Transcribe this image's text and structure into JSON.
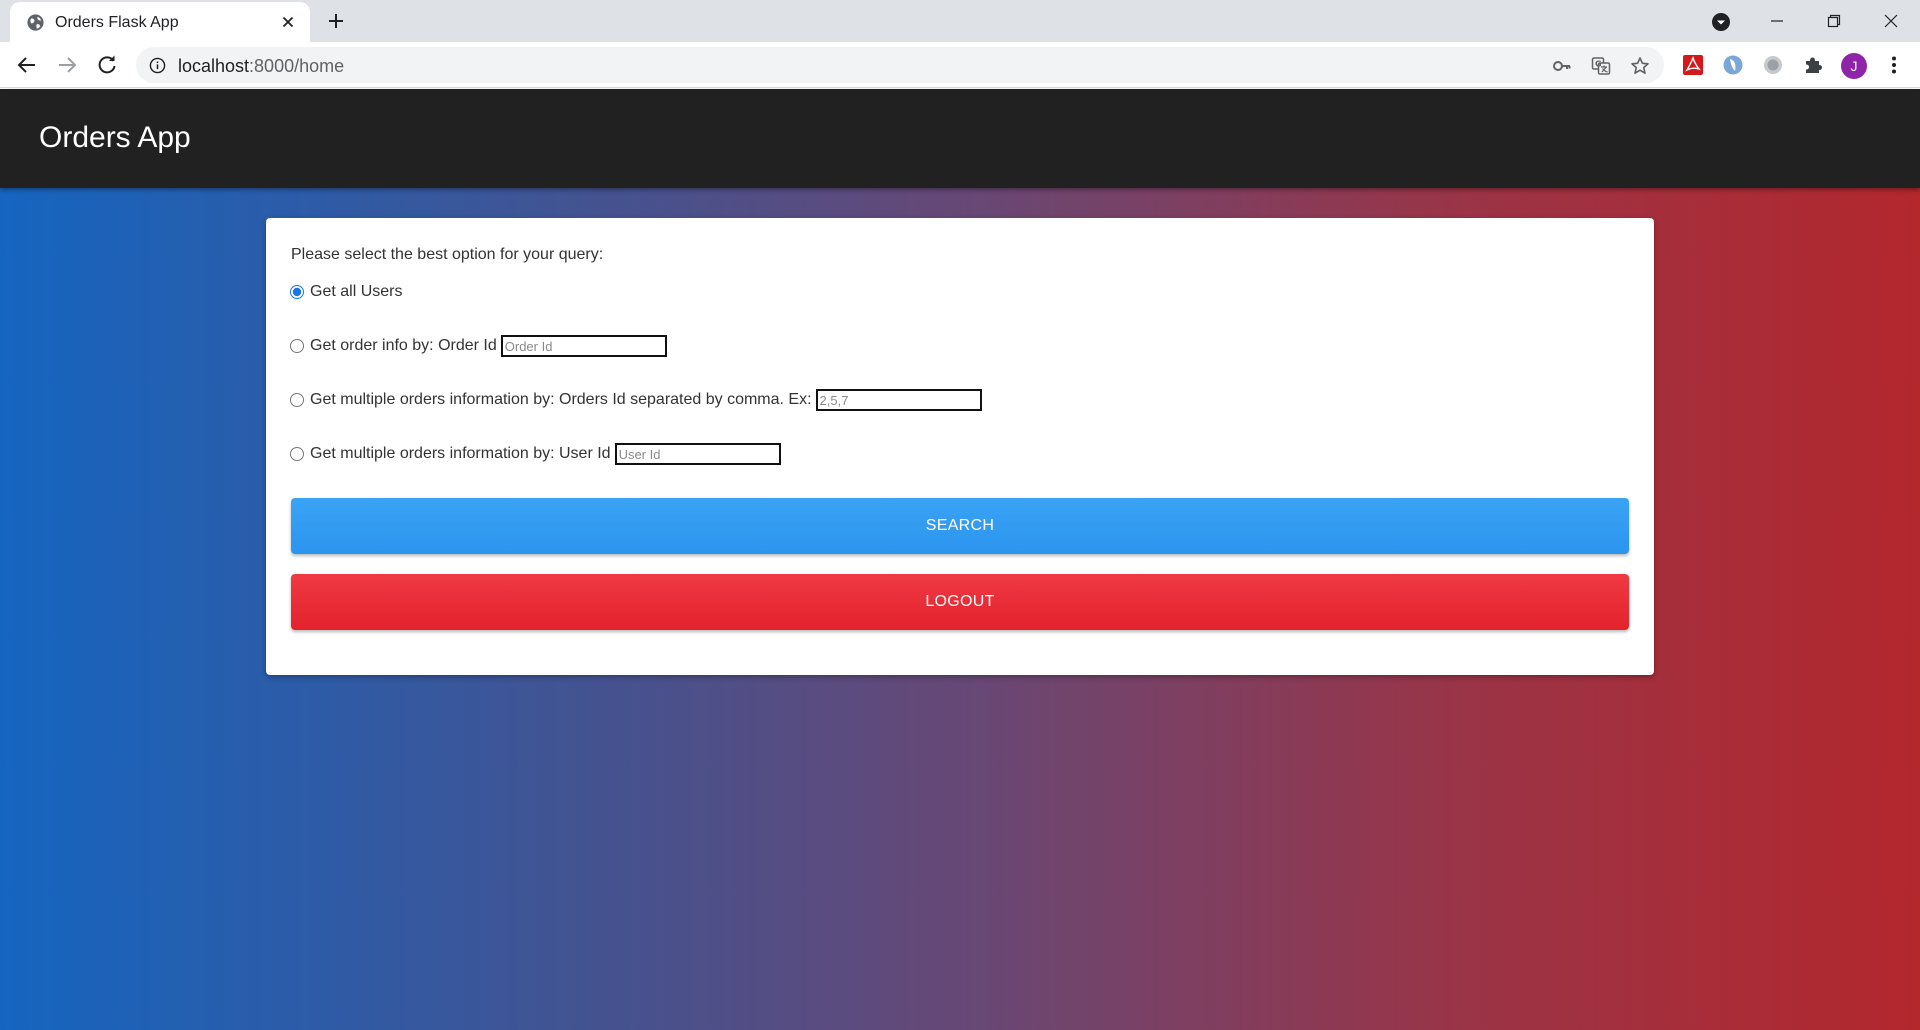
{
  "browser": {
    "tab_title": "Orders Flask App",
    "url_host": "localhost",
    "url_rest": ":8000/home",
    "profile_initial": "J"
  },
  "app": {
    "title": "Orders App",
    "prompt": "Please select the best option for your query:",
    "options": [
      {
        "label": "Get all Users",
        "checked": true
      },
      {
        "label": "Get order info by: Order Id",
        "placeholder": "Order Id",
        "checked": false
      },
      {
        "label": "Get multiple orders information by: Orders Id separated by comma. Ex:",
        "placeholder": "2,5,7",
        "checked": false
      },
      {
        "label": "Get multiple orders information by: User Id",
        "placeholder": "User Id",
        "checked": false
      }
    ],
    "search_label": "SEARCH",
    "logout_label": "LOGOUT"
  },
  "colors": {
    "appbar": "#212121",
    "search_button": "#2b95ef",
    "logout_button": "#e3222c",
    "gradient_left": "#1565c0",
    "gradient_right": "#b3272d"
  }
}
